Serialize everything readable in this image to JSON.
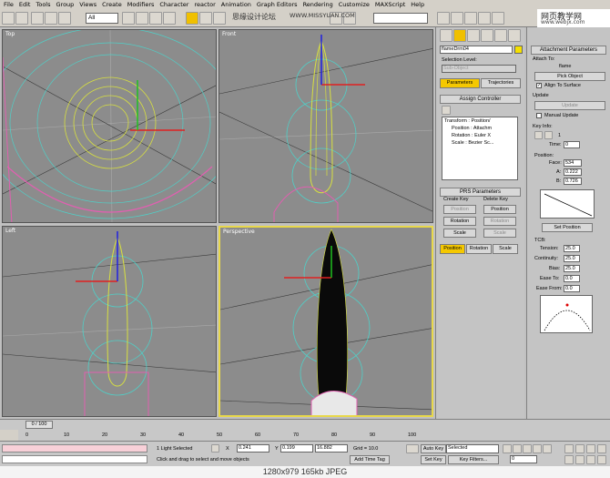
{
  "menu": [
    "File",
    "Edit",
    "Tools",
    "Group",
    "Views",
    "Create",
    "Modifiers",
    "Character",
    "reactor",
    "Animation",
    "Graph Editors",
    "Rendering",
    "Customize",
    "MAXScript",
    "Help"
  ],
  "toolbar": {
    "selection_filter": "All"
  },
  "watermark": {
    "left": "思缘设计论坛",
    "center": "WWW.MISSYUAN.COM",
    "right": "网页教学网",
    "right_url": "www.webjx.com"
  },
  "viewports": {
    "top": "Top",
    "front": "Front",
    "left": "Left",
    "perspective": "Perspective"
  },
  "command_panel": {
    "object_name": "flameDrm04",
    "selection_level_label": "Selection Level:",
    "sub_object": "Sub-Object",
    "tab_parameters": "Parameters",
    "tab_trajectories": "Trajectories",
    "assign_controller": "Assign Controller",
    "tree": [
      "Transform : Position/",
      "Position : Attachm",
      "Rotation : Euler X",
      "Scale : Bezier Sc..."
    ],
    "prs_parameters": "PRS Parameters",
    "create_key": "Create Key",
    "delete_key": "Delete Key",
    "position": "Position",
    "rotation": "Rotation",
    "scale": "Scale"
  },
  "attach_panel": {
    "title": "Attachment Parameters",
    "attach_to": "Attach To:",
    "target": "flame",
    "pick_object": "Pick Object",
    "align_to_surface": "Align To Surface",
    "update_label": "Update",
    "update_btn": "Update",
    "manual_update": "Manual Update",
    "key_info": "Key Info:",
    "key_index": "1",
    "time_label": "Time:",
    "time_value": "0",
    "position_label": "Position:",
    "face_label": "Face:",
    "face_value": "534",
    "a_label": "A:",
    "a_value": "0.222",
    "b_label": "B:",
    "b_value": "0.726",
    "set_position": "Set Position",
    "tcb": "TCB:",
    "tension_label": "Tension:",
    "tension_value": "25.0",
    "continuity_label": "Continuity:",
    "continuity_value": "25.0",
    "bias_label": "Bias:",
    "bias_value": "25.0",
    "ease_to_label": "Ease To:",
    "ease_to_value": "0.0",
    "ease_from_label": "Ease From:",
    "ease_from_value": "0.0"
  },
  "timeline": {
    "frame": "0 / 100",
    "ticks": [
      "0",
      "10",
      "20",
      "30",
      "40",
      "50",
      "60",
      "70",
      "80",
      "90",
      "100"
    ]
  },
  "status": {
    "selected": "1 Light Selected",
    "prompt": "Click and drag to select and move objects",
    "x": "0.241",
    "y": "0.199",
    "z": "16.882",
    "grid": "Grid = 10.0",
    "add_time_tag": "Add Time Tag",
    "auto_key": "Auto Key",
    "selected_dd": "Selected",
    "set_key": "Set Key",
    "key_filters": "Key Filters..."
  },
  "caption": "1280x979  165kb  JPEG",
  "colors": {
    "accent": "#f5c800",
    "viewport": "#8c8c8c",
    "active_border": "#e8d84a"
  }
}
